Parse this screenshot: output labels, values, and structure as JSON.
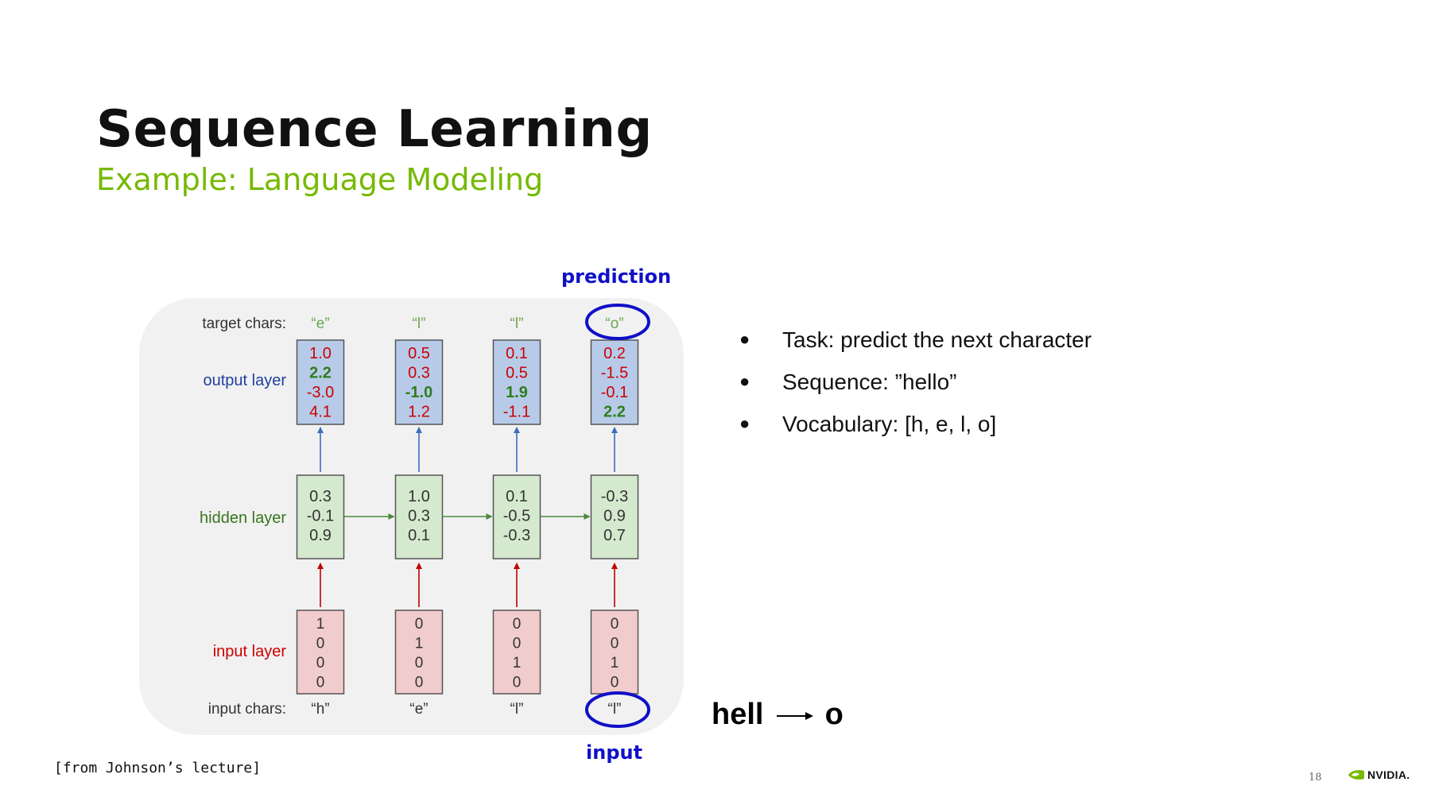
{
  "slide": {
    "title": "Sequence Learning",
    "subtitle": "Example: Language Modeling",
    "source": "[from Johnson’s lecture]",
    "page_number": "18",
    "logo_text": "NVIDIA."
  },
  "bullets": [
    "Task: predict the next character",
    "Sequence: ”hello”",
    "Vocabulary: [h, e, l, o]"
  ],
  "annotations": {
    "prediction": "prediction",
    "input": "input",
    "hell": "hell",
    "o": "o"
  },
  "diagram": {
    "row_labels": {
      "target_chars": "target chars:",
      "output_layer": "output layer",
      "hidden_layer": "hidden layer",
      "input_layer": "input layer",
      "input_chars": "input chars:"
    },
    "colors": {
      "output_fill": "#b7cbe9",
      "hidden_fill": "#d5e9ce",
      "input_fill": "#f1cccc",
      "target_text": "#6aa84f",
      "output_label": "#2040a0",
      "hidden_label": "#38761d",
      "input_label": "#cc0000",
      "red_value": "#cc0000",
      "green_value": "#2e7d1e",
      "blue_arrow": "#3d6cc0",
      "red_arrow": "#c00000",
      "green_arrow": "#4a8a3a",
      "highlight_circle": "#1010c8"
    },
    "steps": [
      {
        "target_char": "“e”",
        "input_char": "“h”",
        "output": [
          {
            "v": "1.0",
            "c": "red"
          },
          {
            "v": "2.2",
            "c": "green"
          },
          {
            "v": "-3.0",
            "c": "red"
          },
          {
            "v": "4.1",
            "c": "red"
          }
        ],
        "hidden": [
          "0.3",
          "-0.1",
          "0.9"
        ],
        "input": [
          "1",
          "0",
          "0",
          "0"
        ]
      },
      {
        "target_char": "“l”",
        "input_char": "“e”",
        "output": [
          {
            "v": "0.5",
            "c": "red"
          },
          {
            "v": "0.3",
            "c": "red"
          },
          {
            "v": "-1.0",
            "c": "green"
          },
          {
            "v": "1.2",
            "c": "red"
          }
        ],
        "hidden": [
          "1.0",
          "0.3",
          "0.1"
        ],
        "input": [
          "0",
          "1",
          "0",
          "0"
        ]
      },
      {
        "target_char": "“l”",
        "input_char": "“l”",
        "output": [
          {
            "v": "0.1",
            "c": "red"
          },
          {
            "v": "0.5",
            "c": "red"
          },
          {
            "v": "1.9",
            "c": "green"
          },
          {
            "v": "-1.1",
            "c": "red"
          }
        ],
        "hidden": [
          "0.1",
          "-0.5",
          "-0.3"
        ],
        "input": [
          "0",
          "0",
          "1",
          "0"
        ]
      },
      {
        "target_char": "“o”",
        "input_char": "“l”",
        "output": [
          {
            "v": "0.2",
            "c": "red"
          },
          {
            "v": "-1.5",
            "c": "red"
          },
          {
            "v": "-0.1",
            "c": "red"
          },
          {
            "v": "2.2",
            "c": "green"
          }
        ],
        "hidden": [
          "-0.3",
          "0.9",
          "0.7"
        ],
        "input": [
          "0",
          "0",
          "1",
          "0"
        ]
      }
    ]
  }
}
